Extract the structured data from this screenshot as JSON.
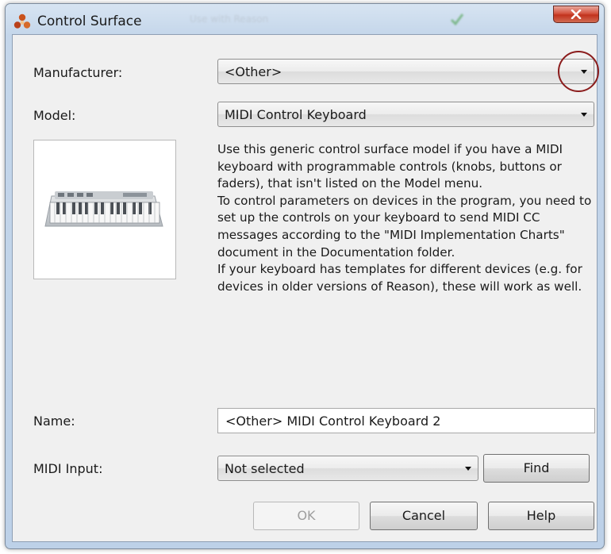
{
  "window": {
    "title": "Control Surface",
    "background_title_blur": "Use with Reason",
    "colors": {
      "close_button": "#c73a25",
      "title_gradient": "#c4d6ea",
      "client_background": "#f0f0f0",
      "highlight_circle": "#8b1c1c"
    }
  },
  "form": {
    "manufacturer": {
      "label": "Manufacturer:",
      "selected": "<Other>"
    },
    "model": {
      "label": "Model:",
      "selected": "MIDI Control Keyboard"
    },
    "description": [
      "Use this generic control surface model if you have a MIDI keyboard with programmable controls (knobs, buttons or faders), that isn't listed on the Model menu.",
      "To control parameters on devices in the program, you need to set up the controls on your keyboard to send MIDI CC messages according to the \"MIDI Implementation Charts\" document in the Documentation folder.",
      "If your keyboard has templates for different devices (e.g. for devices in older versions of Reason), these will work as well."
    ],
    "name": {
      "label": "Name:",
      "value": "<Other> MIDI Control Keyboard 2"
    },
    "midi_input": {
      "label": "MIDI Input:",
      "selected": "Not selected"
    }
  },
  "buttons": {
    "find": "Find",
    "ok": "OK",
    "cancel": "Cancel",
    "help": "Help"
  },
  "icons": {
    "app": "reason-app-icon",
    "close": "close-icon",
    "dropdown": "chevron-down-icon",
    "preview": "midi-keyboard-image"
  }
}
